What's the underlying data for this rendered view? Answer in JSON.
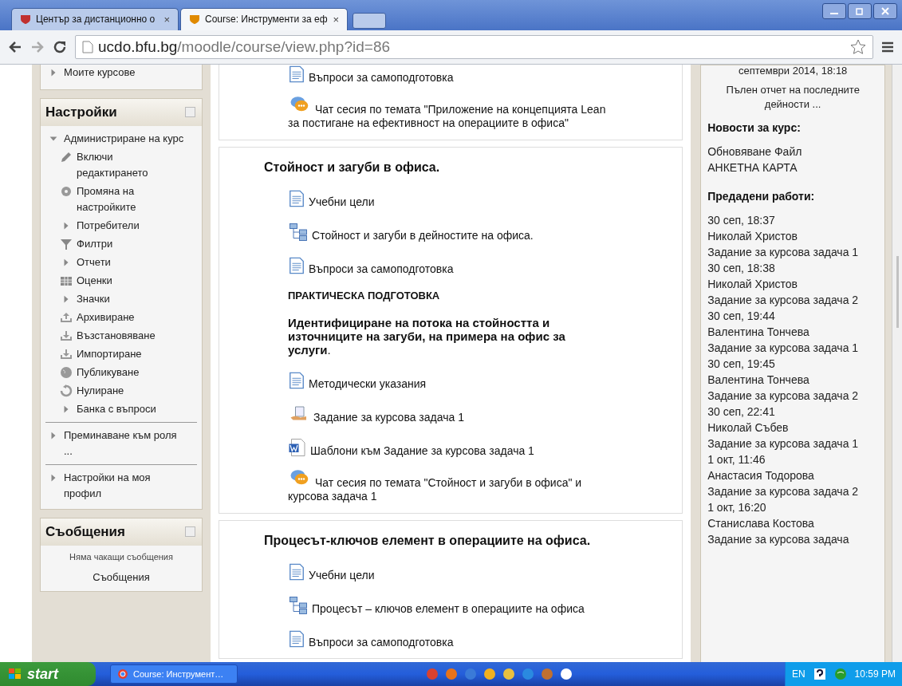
{
  "browser": {
    "tabs": [
      {
        "title": "Център за дистанционно о",
        "selected": false,
        "close": "×"
      },
      {
        "title": "Course: Инструменти за еф",
        "selected": true,
        "close": "×"
      }
    ],
    "url_host": "ucdo.bfu.bg",
    "url_path": "/moodle/course/view.php?id=86"
  },
  "left": {
    "top_item": "Моите курсове",
    "settings": {
      "title": "Настройки",
      "tree": [
        {
          "label": "Администриране на курс",
          "kind": "expanded",
          "children": [
            {
              "label": "Включи редактирането",
              "kind": "pencil"
            },
            {
              "label": "Промяна на настройките",
              "kind": "gear"
            },
            {
              "label": "Потребители",
              "kind": "collapsed"
            },
            {
              "label": "Филтри",
              "kind": "funnel"
            },
            {
              "label": "Отчети",
              "kind": "collapsed"
            },
            {
              "label": "Оценки",
              "kind": "table"
            },
            {
              "label": "Значки",
              "kind": "collapsed"
            },
            {
              "label": "Архивиране",
              "kind": "upload"
            },
            {
              "label": "Възстановяване",
              "kind": "download"
            },
            {
              "label": "Импортиране",
              "kind": "download"
            },
            {
              "label": "Публикуване",
              "kind": "globe"
            },
            {
              "label": "Нулиране",
              "kind": "reset"
            },
            {
              "label": "Банка с въпроси",
              "kind": "collapsed"
            }
          ]
        }
      ],
      "groups": [
        {
          "label": "Преминаване към роля ..."
        },
        {
          "label": "Настройки на моя профил"
        }
      ]
    },
    "messages": {
      "title": "Съобщения",
      "note": "Няма чакащи съобщения",
      "link": "Съобщения"
    }
  },
  "sections": [
    {
      "items": [
        {
          "kind": "page",
          "text": "Въпроси за самоподготовка"
        },
        {
          "kind": "chat",
          "text": "Чат сесия по темата \"Приложение на концепцията Lean за постигане на ефективност на операциите в офиса\""
        }
      ]
    },
    {
      "title": "Стойност и загуби в офиса.",
      "items": [
        {
          "kind": "page",
          "text": "Учебни цели"
        },
        {
          "kind": "book",
          "text": "Стойност и загуби в дейностите на офиса."
        },
        {
          "kind": "page",
          "text": "Въпроси за самоподготовка"
        },
        {
          "kind": "label",
          "text": "**ПРАКТИЧЕСКА ПОДГОТОВКА**"
        },
        {
          "kind": "heading",
          "text": "**Идентифициране на потока на стойността и източниците на загуби, на примера на офис за услуги**."
        },
        {
          "kind": "page",
          "text": "Методически указания"
        },
        {
          "kind": "assignment",
          "text": "Задание за курсова задача 1"
        },
        {
          "kind": "word",
          "text": "Шаблони към Задание за курсова задача 1"
        },
        {
          "kind": "chat",
          "text": "Чат сесия по темата \"Стойност и загуби в офиса\" и курсова задача 1"
        }
      ]
    },
    {
      "title": "Процесът-ключов елемент в операциите на офиса.",
      "items": [
        {
          "kind": "page",
          "text": "Учебни цели"
        },
        {
          "kind": "book",
          "text": "Процесът – ключов елемент в операциите на офиса"
        },
        {
          "kind": "page",
          "text": "Въпроси за самоподготовка"
        }
      ]
    }
  ],
  "right": {
    "since": "септември 2014, 18:18",
    "report_link": "Пълен отчет на последните дейности ...",
    "news_title": "Новости за курс:",
    "news": "Обновяване Файл АНКЕТНА КАРТА",
    "submissions_title": "Предадени работи:",
    "submissions": [
      {
        "date": "30 сеп, 18:37",
        "name": "Николай Христов",
        "task": "Задание за курсова задача 1"
      },
      {
        "date": "30 сеп, 18:38",
        "name": "Николай Христов",
        "task": "Задание за курсова задача 2"
      },
      {
        "date": "30 сеп, 19:44",
        "name": "Валентина Тончева",
        "task": "Задание за курсова задача 1"
      },
      {
        "date": "30 сеп, 19:45",
        "name": "Валентина Тончева",
        "task": "Задание за курсова задача 2"
      },
      {
        "date": "30 сеп, 22:41",
        "name": "Николай Събев",
        "task": "Задание за курсова задача 1"
      },
      {
        "date": "1 окт, 11:46",
        "name": "Анастасия Тодорова",
        "task": "Задание за курсова задача 2"
      },
      {
        "date": "1 окт, 16:20",
        "name": "Станислава Костова",
        "task": "Задание за курсова задача"
      }
    ]
  },
  "taskbar": {
    "start": "start",
    "task": "Course: Инструмент…",
    "lang": "EN",
    "time": "10:59 PM"
  }
}
